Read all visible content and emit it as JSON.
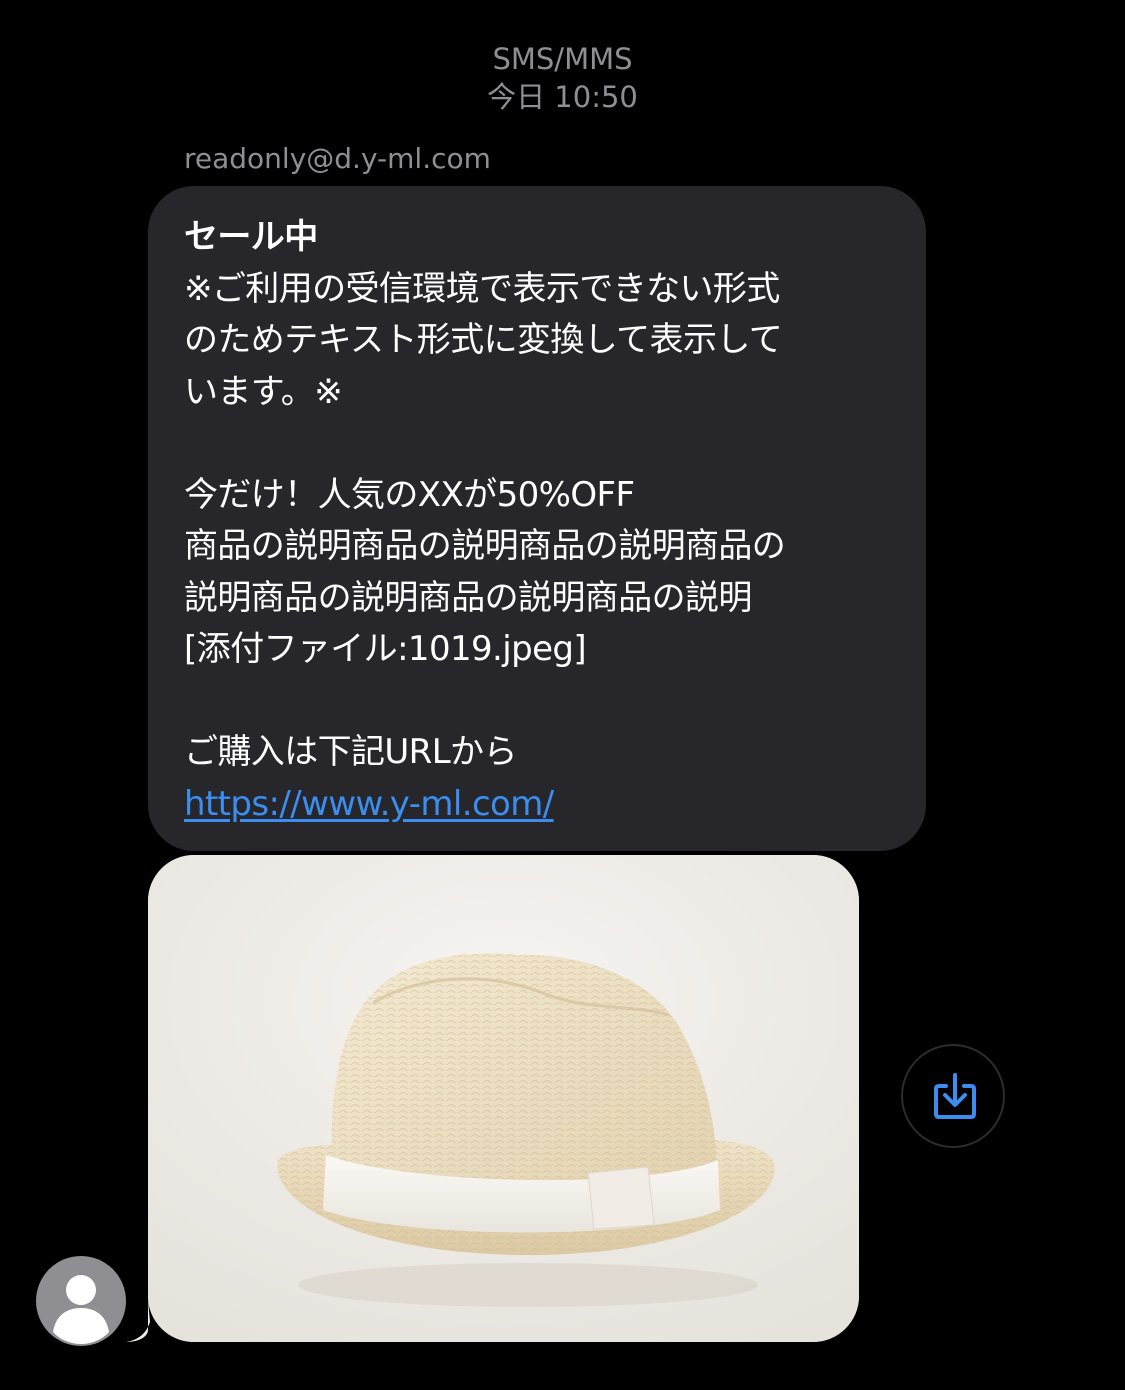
{
  "header": {
    "channel": "SMS/MMS",
    "timestamp": "今日 10:50"
  },
  "message": {
    "sender": "readonly@d.y-ml.com",
    "title": "セール中",
    "lines": [
      "※ご利用の受信環境で表示できない形式",
      "のためテキスト形式に変換して表示して",
      "います。※",
      "",
      "今だけ！人気のXXが50%OFF",
      "商品の説明商品の説明商品の説明商品の",
      "説明商品の説明商品の説明商品の説明",
      "[添付ファイル:1019.jpeg]",
      "",
      "ご購入は下記URLから"
    ],
    "link": "https://www.y-ml.com/"
  },
  "attachment": {
    "alt": "1019.jpeg",
    "subject": "straw-hat"
  },
  "icons": {
    "save": "save-download-icon",
    "avatar": "person-icon"
  },
  "colors": {
    "background": "#000000",
    "bubble": "#26262b",
    "link": "#3b8ef0",
    "meta_text": "#8e8e93"
  }
}
